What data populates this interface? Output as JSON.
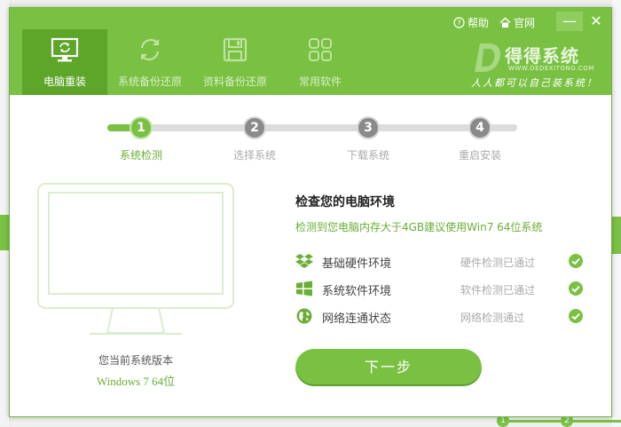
{
  "colors": {
    "accent": "#7ac143",
    "accent_dark": "#5ea62a"
  },
  "header": {
    "help_label": "帮助",
    "site_label": "官网",
    "minimize": "—",
    "close": "✕",
    "brand": {
      "name": "得得系统",
      "url": "WWW.DEDEXITONG.COM",
      "slogan": "人人都可以自己装系统！"
    },
    "nav": [
      {
        "label": "电脑重装",
        "icon": "monitor-refresh-icon",
        "active": true
      },
      {
        "label": "系统备份还原",
        "icon": "sync-icon",
        "active": false
      },
      {
        "label": "资料备份还原",
        "icon": "save-disk-icon",
        "active": false
      },
      {
        "label": "常用软件",
        "icon": "apps-grid-icon",
        "active": false
      }
    ]
  },
  "steps": [
    {
      "number": "1",
      "label": "系统检测",
      "active": true
    },
    {
      "number": "2",
      "label": "选择系统",
      "active": false
    },
    {
      "number": "3",
      "label": "下载系统",
      "active": false
    },
    {
      "number": "4",
      "label": "重启安装",
      "active": false
    }
  ],
  "monitor": {
    "title": "您当前系统版本",
    "version": "Windows 7 64位"
  },
  "check": {
    "title": "检查您的电脑环境",
    "subtitle": "检测到您电脑内存大于4GB建议使用Win7 64位系统",
    "items": [
      {
        "name": "基础硬件环境",
        "status": "硬件检测已通过",
        "icon": "dropbox-icon"
      },
      {
        "name": "系统软件环境",
        "status": "软件检测已通过",
        "icon": "windows-icon"
      },
      {
        "name": "网络连通状态",
        "status": "网络检测通过",
        "icon": "globe-icon"
      }
    ]
  },
  "next_button": "下一步",
  "background_fragments": {
    "step_1": "1",
    "step_2": "2"
  }
}
